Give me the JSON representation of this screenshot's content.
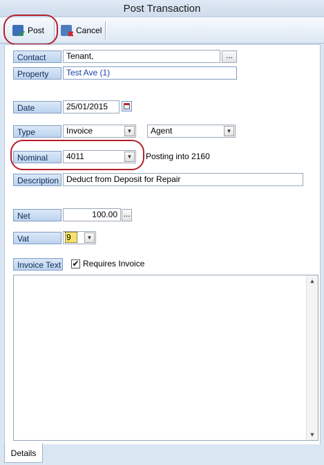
{
  "window": {
    "title": "Post Transaction"
  },
  "toolbar": {
    "post_label": "Post",
    "cancel_label": "Cancel"
  },
  "form": {
    "contact": {
      "label": "Contact",
      "value": "Tenant,",
      "button": "..."
    },
    "property": {
      "label": "Property",
      "value": "Test Ave (1)"
    },
    "date": {
      "label": "Date",
      "value": "25/01/2015"
    },
    "type": {
      "label": "Type",
      "value": "Invoice",
      "second_value": "Agent"
    },
    "nominal": {
      "label": "Nominal",
      "value": "4011",
      "note": "Posting into 2160"
    },
    "description": {
      "label": "Description",
      "value": "Deduct from Deposit for Repair"
    },
    "net": {
      "label": "Net",
      "value": "100.00",
      "button": "..."
    },
    "vat": {
      "label": "Vat",
      "value": "9"
    },
    "invoice_text": {
      "label": "Invoice Text",
      "checkbox_label": "Requires Invoice",
      "checked": true,
      "text": ""
    }
  },
  "tabs": [
    {
      "label": "Details"
    }
  ],
  "icons": {
    "post": "save-check-icon",
    "cancel": "cancel-icon",
    "calendar": "calendar-icon",
    "dropdown": "chevron-down-icon",
    "checkmark": "checkmark-icon"
  },
  "colors": {
    "label_text": "#0d2a55",
    "highlight_oval": "#b41e2a",
    "property_text": "#1a3fa8",
    "vat_highlight": "#f6e26a"
  }
}
